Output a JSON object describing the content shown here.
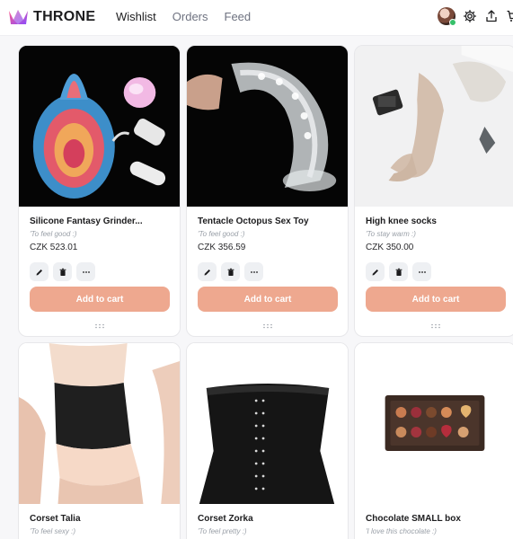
{
  "app": {
    "brand": "THRONE"
  },
  "nav": [
    {
      "label": "Wishlist",
      "active": true
    },
    {
      "label": "Orders",
      "active": false
    },
    {
      "label": "Feed",
      "active": false
    }
  ],
  "header_icons": [
    "avatar",
    "gear-icon",
    "share-icon",
    "cart-icon"
  ],
  "colors": {
    "accent": "#eea88f",
    "text": "#1c1c1e",
    "muted": "#9aa0a8"
  },
  "items": [
    {
      "title": "Silicone Fantasy Grinder...",
      "note": "'To feel good :)",
      "price": "CZK 523.01",
      "add_label": "Add to cart"
    },
    {
      "title": "Tentacle Octopus Sex Toy",
      "note": "'To feel good :)",
      "price": "CZK 356.59",
      "add_label": "Add to cart"
    },
    {
      "title": "High knee socks",
      "note": "'To stay warm :)",
      "price": "CZK 350.00",
      "add_label": "Add to cart"
    },
    {
      "title": "Corset Talia",
      "note": "'To feel sexy :)"
    },
    {
      "title": "Corset Zorka",
      "note": "'To feel pretty :)"
    },
    {
      "title": "Chocolate SMALL box",
      "note": "'I love this chocolate :)"
    }
  ],
  "item_tool_icons": [
    "edit-icon",
    "trash-icon",
    "more-icon"
  ]
}
